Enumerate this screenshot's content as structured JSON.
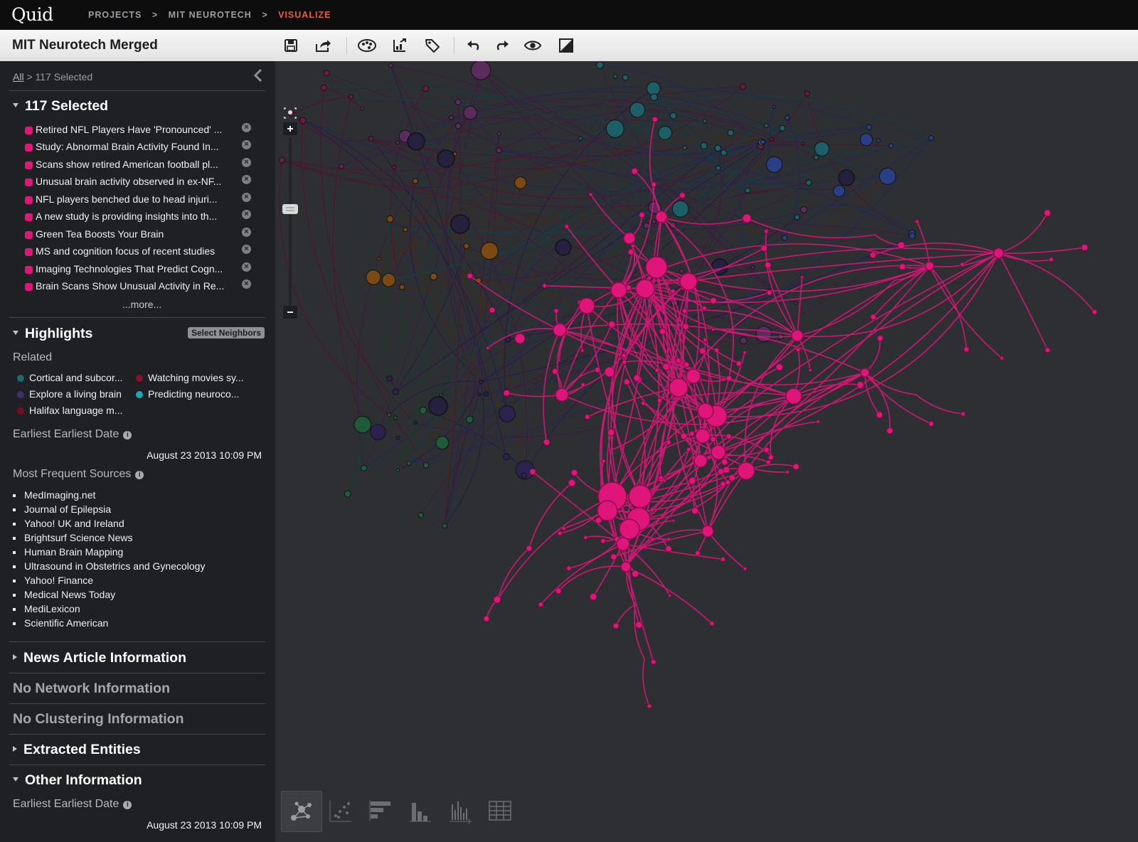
{
  "app": {
    "logo": "Quid",
    "breadcrumb": [
      "PROJECTS",
      "MIT NEUROTECH",
      "VISUALIZE"
    ],
    "breadcrumb_sep": ">"
  },
  "toolbar": {
    "title": "MIT Neurotech Merged",
    "icons": [
      "save-icon",
      "share-icon",
      "palette-icon",
      "export-icon",
      "tag-icon",
      "undo-icon",
      "redo-icon",
      "eye-icon",
      "contrast-icon"
    ]
  },
  "sidebar": {
    "crumb_all": "All",
    "crumb_rest": "> 117 Selected",
    "selected": {
      "title": "117 Selected",
      "items": [
        "Retired NFL Players Have 'Pronounced' ...",
        "Study: Abnormal Brain Activity Found In...",
        "Scans show retired American football pl...",
        "Unusual brain activity observed in ex-NF...",
        "NFL players benched due to head injuri...",
        "A new study is providing insights into th...",
        "Green Tea Boosts Your Brain",
        "MS and cognition focus of recent studies",
        "Imaging Technologies That Predict Cogn...",
        "Brain Scans Show Unusual Activity in Re..."
      ],
      "more": "...more..."
    },
    "highlights": {
      "title": "Highlights",
      "select_neighbors": "Select Neighbors",
      "related_label": "Related",
      "related": [
        {
          "label": "Cortical and subcor...",
          "color": "#1b6a6f"
        },
        {
          "label": "Watching movies sy...",
          "color": "#8a0f2a"
        },
        {
          "label": "Explore a living brain",
          "color": "#3d2d6b"
        },
        {
          "label": "Predicting neuroco...",
          "color": "#1aa8b8"
        },
        {
          "label": "Halifax language m...",
          "color": "#7a0c22"
        }
      ],
      "earliest_label": "Earliest Earliest Date",
      "earliest_value": "August 23 2013 10:09 PM",
      "sources_label": "Most Frequent Sources",
      "sources": [
        "MedImaging.net",
        "Journal of Epilepsia",
        "Yahoo! UK and Ireland",
        "Brightsurf Science News",
        "Human Brain Mapping",
        "Ultrasound in Obstetrics and Gynecology",
        "Yahoo! Finance",
        "Medical News Today",
        "MediLexicon",
        "Scientific American"
      ]
    },
    "sections": {
      "news_article": "News Article Information",
      "no_network": "No Network Information",
      "no_clustering": "No Clustering Information",
      "extracted": "Extracted Entities",
      "other": "Other Information"
    },
    "other": {
      "earliest_label": "Earliest Earliest Date",
      "earliest_value": "August 23 2013 10:09 PM"
    }
  },
  "canvas": {
    "highlight_color": "#e0157a",
    "view_modes": [
      "network-view-icon",
      "scatter-view-icon",
      "bar-horizontal-icon",
      "histogram-icon",
      "timeline-icon",
      "table-view-icon"
    ]
  }
}
